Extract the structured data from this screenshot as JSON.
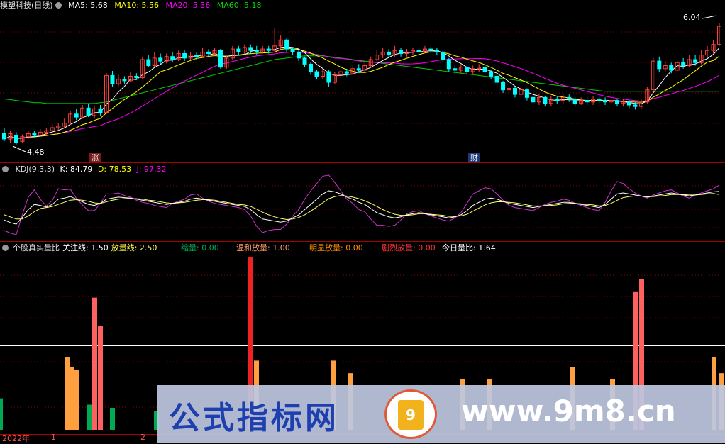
{
  "colors": {
    "up": "#ff4040",
    "down": "#00ffff",
    "ma5": "#ffffff",
    "ma10": "#ffff00",
    "ma20": "#ff00ff",
    "ma60": "#00cc00",
    "grid": "#8b0000",
    "vol_green": "#00aa55",
    "vol_orange": "#ffa040",
    "vol_pink": "#ff6060",
    "vol_red": "#ee2222"
  },
  "main": {
    "title": "模塑科技(日线)",
    "ma5": "MA5: 5.68",
    "ma10": "MA10: 5.56",
    "ma20": "MA20: 5.36",
    "ma60": "MA60: 5.18",
    "high_label": "6.04",
    "low_label": "4.48",
    "tag_zhang": "涨",
    "tag_cai": "财"
  },
  "kdj": {
    "title": "KDJ(9,3,3)",
    "k": "K: 84.79",
    "d": "D: 78.53",
    "j": "J: 97.32"
  },
  "vol": {
    "title": "个股真实量比",
    "focus": "关注线: 1.50",
    "volume_line": "放量线: 2.50",
    "shrink": "缩量: 0.00",
    "mild": "温和放量: 1.00",
    "obvious": "明显放量: 0.00",
    "intense": "剧烈放量: 0.00",
    "today": "今日量比: 1.64"
  },
  "axis": {
    "year": "2022年",
    "m1": "1",
    "m2": "2"
  },
  "banner": {
    "text": "公式指标网",
    "url": "www.9m8.cn",
    "logo": "9"
  },
  "chart_data": {
    "type": "candlestick",
    "price_range": [
      4.4,
      6.2
    ],
    "candles": [
      [
        4.62,
        4.55,
        4.7,
        4.52
      ],
      [
        4.55,
        4.62,
        4.66,
        4.5
      ],
      [
        4.6,
        4.5,
        4.64,
        4.48
      ],
      [
        4.52,
        4.58,
        4.61,
        4.5
      ],
      [
        4.58,
        4.62,
        4.66,
        4.55
      ],
      [
        4.62,
        4.6,
        4.66,
        4.57
      ],
      [
        4.6,
        4.64,
        4.68,
        4.58
      ],
      [
        4.64,
        4.66,
        4.7,
        4.6
      ],
      [
        4.66,
        4.7,
        4.74,
        4.63
      ],
      [
        4.7,
        4.72,
        4.76,
        4.67
      ],
      [
        4.72,
        4.76,
        4.82,
        4.7
      ],
      [
        4.76,
        4.88,
        4.92,
        4.74
      ],
      [
        4.88,
        4.84,
        4.95,
        4.8
      ],
      [
        4.84,
        4.96,
        5.0,
        4.82
      ],
      [
        4.96,
        4.86,
        5.02,
        4.84
      ],
      [
        4.86,
        4.95,
        4.98,
        4.82
      ],
      [
        4.95,
        4.9,
        5.0,
        4.86
      ],
      [
        4.9,
        5.39,
        5.42,
        4.88
      ],
      [
        5.39,
        5.28,
        5.45,
        5.24
      ],
      [
        5.28,
        5.34,
        5.4,
        5.25
      ],
      [
        5.34,
        5.32,
        5.38,
        5.28
      ],
      [
        5.32,
        5.38,
        5.44,
        5.3
      ],
      [
        5.38,
        5.36,
        5.42,
        5.33
      ],
      [
        5.36,
        5.6,
        5.64,
        5.34
      ],
      [
        5.6,
        5.52,
        5.66,
        5.5
      ],
      [
        5.52,
        5.62,
        5.7,
        5.5
      ],
      [
        5.62,
        5.58,
        5.68,
        5.54
      ],
      [
        5.58,
        5.64,
        5.68,
        5.55
      ],
      [
        5.64,
        5.6,
        5.7,
        5.57
      ],
      [
        5.6,
        5.68,
        5.72,
        5.58
      ],
      [
        5.68,
        5.62,
        5.72,
        5.58
      ],
      [
        5.62,
        5.66,
        5.7,
        5.6
      ],
      [
        5.66,
        5.64,
        5.7,
        5.6
      ],
      [
        5.64,
        5.7,
        5.76,
        5.62
      ],
      [
        5.7,
        5.68,
        5.74,
        5.64
      ],
      [
        5.68,
        5.72,
        5.76,
        5.65
      ],
      [
        5.72,
        5.5,
        5.74,
        5.48
      ],
      [
        5.5,
        5.62,
        5.66,
        5.48
      ],
      [
        5.62,
        5.74,
        5.78,
        5.6
      ],
      [
        5.74,
        5.7,
        5.78,
        5.66
      ],
      [
        5.7,
        5.76,
        5.8,
        5.68
      ],
      [
        5.76,
        5.72,
        5.8,
        5.68
      ],
      [
        5.72,
        5.7,
        5.78,
        5.66
      ],
      [
        5.7,
        5.74,
        5.78,
        5.68
      ],
      [
        5.74,
        5.72,
        5.78,
        5.68
      ],
      [
        5.72,
        5.78,
        6.02,
        5.7
      ],
      [
        5.78,
        5.86,
        5.92,
        5.74
      ],
      [
        5.86,
        5.74,
        5.88,
        5.7
      ],
      [
        5.74,
        5.7,
        5.76,
        5.66
      ],
      [
        5.7,
        5.62,
        5.72,
        5.58
      ],
      [
        5.62,
        5.54,
        5.64,
        5.5
      ],
      [
        5.54,
        5.44,
        5.56,
        5.4
      ],
      [
        5.44,
        5.38,
        5.46,
        5.34
      ],
      [
        5.38,
        5.44,
        5.48,
        5.34
      ],
      [
        5.44,
        5.3,
        5.46,
        5.24
      ],
      [
        5.3,
        5.4,
        5.44,
        5.28
      ],
      [
        5.4,
        5.44,
        5.48,
        5.36
      ],
      [
        5.44,
        5.42,
        5.48,
        5.38
      ],
      [
        5.42,
        5.48,
        5.52,
        5.4
      ],
      [
        5.48,
        5.46,
        5.54,
        5.42
      ],
      [
        5.46,
        5.52,
        5.56,
        5.44
      ],
      [
        5.52,
        5.6,
        5.64,
        5.5
      ],
      [
        5.6,
        5.66,
        5.72,
        5.58
      ],
      [
        5.66,
        5.7,
        5.76,
        5.62
      ],
      [
        5.7,
        5.66,
        5.74,
        5.62
      ],
      [
        5.66,
        5.72,
        5.78,
        5.64
      ],
      [
        5.72,
        5.68,
        5.76,
        5.64
      ],
      [
        5.68,
        5.7,
        5.74,
        5.64
      ],
      [
        5.7,
        5.72,
        5.76,
        5.66
      ],
      [
        5.72,
        5.7,
        5.76,
        5.66
      ],
      [
        5.7,
        5.74,
        5.78,
        5.68
      ],
      [
        5.74,
        5.72,
        5.78,
        5.68
      ],
      [
        5.72,
        5.7,
        5.76,
        5.66
      ],
      [
        5.7,
        5.6,
        5.72,
        5.56
      ],
      [
        5.6,
        5.48,
        5.62,
        5.44
      ],
      [
        5.48,
        5.46,
        5.52,
        5.4
      ],
      [
        5.46,
        5.5,
        5.54,
        5.42
      ],
      [
        5.5,
        5.44,
        5.52,
        5.4
      ],
      [
        5.44,
        5.48,
        5.52,
        5.4
      ],
      [
        5.48,
        5.5,
        5.54,
        5.44
      ],
      [
        5.5,
        5.44,
        5.52,
        5.4
      ],
      [
        5.44,
        5.38,
        5.46,
        5.34
      ],
      [
        5.38,
        5.3,
        5.4,
        5.24
      ],
      [
        5.3,
        5.2,
        5.32,
        5.16
      ],
      [
        5.2,
        5.22,
        5.26,
        5.14
      ],
      [
        5.22,
        5.14,
        5.24,
        5.1
      ],
      [
        5.14,
        5.2,
        5.24,
        5.1
      ],
      [
        5.2,
        5.1,
        5.22,
        5.06
      ],
      [
        5.1,
        5.04,
        5.12,
        5.0
      ],
      [
        5.04,
        5.1,
        5.14,
        5.0
      ],
      [
        5.1,
        5.02,
        5.12,
        4.98
      ],
      [
        5.02,
        5.08,
        5.12,
        4.98
      ],
      [
        5.08,
        5.06,
        5.12,
        5.02
      ],
      [
        5.06,
        5.1,
        5.14,
        5.02
      ],
      [
        5.1,
        5.08,
        5.14,
        5.04
      ],
      [
        5.08,
        5.02,
        5.1,
        4.98
      ],
      [
        5.02,
        5.06,
        5.1,
        5.0
      ],
      [
        5.06,
        5.04,
        5.1,
        5.0
      ],
      [
        5.04,
        5.08,
        5.12,
        5.0
      ],
      [
        5.08,
        5.06,
        5.12,
        5.02
      ],
      [
        5.06,
        5.04,
        5.1,
        5.0
      ],
      [
        5.04,
        5.06,
        5.1,
        5.0
      ],
      [
        5.06,
        5.02,
        5.08,
        4.98
      ],
      [
        5.02,
        5.04,
        5.08,
        4.98
      ],
      [
        5.04,
        5.0,
        5.06,
        4.96
      ],
      [
        5.0,
        4.98,
        5.04,
        4.94
      ],
      [
        4.98,
        5.04,
        5.08,
        4.94
      ],
      [
        5.04,
        5.2,
        5.24,
        5.02
      ],
      [
        5.2,
        5.58,
        5.62,
        5.18
      ],
      [
        5.58,
        5.48,
        5.64,
        5.44
      ],
      [
        5.48,
        5.52,
        5.58,
        5.44
      ],
      [
        5.52,
        5.46,
        5.56,
        5.42
      ],
      [
        5.46,
        5.56,
        5.6,
        5.44
      ],
      [
        5.56,
        5.52,
        5.62,
        5.48
      ],
      [
        5.52,
        5.6,
        5.66,
        5.5
      ],
      [
        5.6,
        5.56,
        5.66,
        5.52
      ],
      [
        5.56,
        5.66,
        5.72,
        5.54
      ],
      [
        5.66,
        5.72,
        5.78,
        5.62
      ],
      [
        5.72,
        5.8,
        5.86,
        5.68
      ],
      [
        5.8,
        6.04,
        6.08,
        5.78
      ]
    ],
    "ma60": [
      5.08,
      5.07,
      5.06,
      5.05,
      5.04,
      5.03,
      5.03,
      5.02,
      5.02,
      5.02,
      5.02,
      5.02,
      5.02,
      5.02,
      5.02,
      5.02,
      5.03,
      5.04,
      5.06,
      5.08,
      5.1,
      5.12,
      5.14,
      5.16,
      5.18,
      5.2,
      5.22,
      5.24,
      5.26,
      5.28,
      5.3,
      5.32,
      5.34,
      5.36,
      5.38,
      5.4,
      5.42,
      5.44,
      5.46,
      5.48,
      5.5,
      5.52,
      5.54,
      5.56,
      5.58,
      5.6,
      5.61,
      5.62,
      5.63,
      5.64,
      5.65,
      5.65,
      5.65,
      5.65,
      5.64,
      5.63,
      5.62,
      5.61,
      5.6,
      5.59,
      5.58,
      5.57,
      5.56,
      5.55,
      5.54,
      5.53,
      5.52,
      5.51,
      5.5,
      5.49,
      5.48,
      5.47,
      5.46,
      5.45,
      5.44,
      5.43,
      5.42,
      5.41,
      5.4,
      5.39,
      5.38,
      5.37,
      5.36,
      5.35,
      5.34,
      5.33,
      5.32,
      5.31,
      5.3,
      5.29,
      5.28,
      5.27,
      5.26,
      5.25,
      5.24,
      5.23,
      5.22,
      5.21,
      5.2,
      5.19,
      5.18,
      5.18,
      5.18,
      5.18,
      5.18,
      5.18,
      5.18,
      5.18,
      5.18,
      5.18,
      5.18,
      5.18,
      5.18,
      5.18,
      5.18,
      5.18,
      5.18,
      5.18,
      5.18,
      5.18
    ],
    "kdj_k": [
      30,
      25,
      22,
      35,
      50,
      60,
      58,
      55,
      60,
      70,
      72,
      75,
      70,
      65,
      60,
      58,
      62,
      70,
      72,
      74,
      73,
      72,
      70,
      68,
      66,
      64,
      62,
      60,
      62,
      64,
      66,
      70,
      72,
      70,
      68,
      66,
      64,
      62,
      60,
      58,
      56,
      50,
      40,
      32,
      30,
      28,
      26,
      28,
      34,
      40,
      50,
      60,
      70,
      80,
      86,
      84,
      80,
      74,
      70,
      64,
      60,
      52,
      44,
      40,
      36,
      34,
      36,
      40,
      42,
      44,
      42,
      40,
      38,
      36,
      34,
      36,
      40,
      48,
      58,
      64,
      70,
      72,
      70,
      66,
      62,
      60,
      58,
      56,
      54,
      56,
      58,
      60,
      62,
      64,
      64,
      62,
      60,
      58,
      56,
      54,
      60,
      70,
      80,
      82,
      80,
      78,
      76,
      74,
      76,
      78,
      80,
      82,
      80,
      78,
      76,
      78,
      80,
      82,
      84,
      85
    ],
    "kdj_d": [
      40,
      36,
      32,
      32,
      38,
      46,
      52,
      54,
      56,
      60,
      64,
      68,
      69,
      68,
      66,
      63,
      62,
      65,
      68,
      70,
      71,
      71,
      71,
      70,
      68,
      67,
      65,
      63,
      62,
      63,
      64,
      66,
      68,
      69,
      69,
      68,
      66,
      64,
      62,
      60,
      59,
      56,
      51,
      45,
      40,
      36,
      33,
      31,
      32,
      35,
      40,
      47,
      55,
      63,
      71,
      75,
      77,
      76,
      74,
      71,
      67,
      62,
      56,
      50,
      45,
      41,
      39,
      39,
      40,
      42,
      42,
      41,
      40,
      39,
      37,
      37,
      38,
      41,
      47,
      53,
      59,
      63,
      65,
      65,
      64,
      63,
      61,
      59,
      57,
      57,
      57,
      58,
      59,
      61,
      62,
      62,
      61,
      60,
      59,
      57,
      58,
      62,
      68,
      73,
      75,
      76,
      76,
      75,
      75,
      76,
      77,
      79,
      79,
      79,
      78,
      78,
      79,
      80,
      81,
      79
    ],
    "kdj_j": [
      10,
      5,
      2,
      40,
      74,
      88,
      70,
      57,
      68,
      90,
      88,
      89,
      72,
      59,
      48,
      48,
      62,
      80,
      80,
      82,
      77,
      74,
      68,
      64,
      62,
      58,
      56,
      54,
      62,
      66,
      70,
      78,
      80,
      72,
      66,
      62,
      60,
      58,
      56,
      54,
      50,
      38,
      18,
      6,
      10,
      12,
      12,
      22,
      38,
      50,
      70,
      86,
      100,
      114,
      116,
      102,
      86,
      70,
      62,
      50,
      46,
      32,
      20,
      20,
      18,
      20,
      30,
      42,
      46,
      48,
      42,
      38,
      34,
      30,
      28,
      34,
      44,
      62,
      80,
      86,
      92,
      90,
      80,
      68,
      58,
      54,
      52,
      50,
      48,
      54,
      60,
      64,
      66,
      70,
      68,
      62,
      58,
      54,
      50,
      48,
      64,
      86,
      104,
      100,
      90,
      82,
      76,
      72,
      78,
      82,
      86,
      88,
      82,
      76,
      72,
      78,
      82,
      86,
      90,
      97
    ]
  }
}
